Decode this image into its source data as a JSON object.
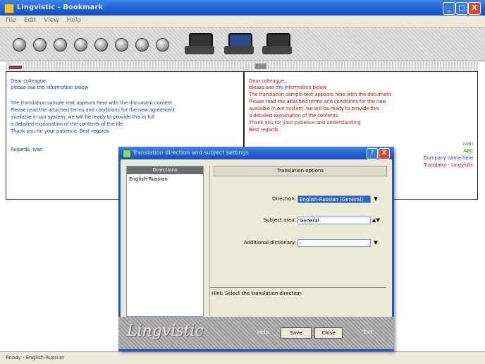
{
  "window": {
    "title": "Lingvistic - Bookmark",
    "controls": {
      "minimize": "_",
      "maximize": "□",
      "close": "X"
    }
  },
  "menu": [
    "File",
    "Edit",
    "View",
    "Help"
  ],
  "toolbar": {
    "round_buttons": 8,
    "big_buttons": 3
  },
  "flags": {
    "left_colors": [
      "#ffffff",
      "#2c4fa3",
      "#d1262a"
    ]
  },
  "left_pane": {
    "lines": [
      {
        "text": "Dear colleague,",
        "color": "#1f3fb5"
      },
      {
        "text": "please see the information below",
        "color": "#1f3fb5"
      },
      {
        "text": "The translation sample text appears here with the document content",
        "color": "#1f3fb5"
      },
      {
        "text": "Please read the attached terms and conditions for the new agreement",
        "color": "#1f3fb5"
      },
      {
        "text": "available in our system, we will be ready to provide this in full",
        "color": "#1f3fb5"
      },
      {
        "text": "a detailed explanation of the contents of the file",
        "color": "#1f3fb5"
      },
      {
        "text": "Thank you for your patience. Best regards",
        "color": "#1f3fb5"
      },
      {
        "text": "Regards, Ivan",
        "color": "#1f3fb5"
      }
    ]
  },
  "right_pane": {
    "lines": [
      {
        "text": "Dear colleague,",
        "color": "#c01818"
      },
      {
        "text": "please see the information below",
        "color": "#c01818"
      },
      {
        "text": "The translation sample text appears here with the document",
        "color": "#c01818"
      },
      {
        "text": "Please read the attached terms and conditions for the new",
        "color": "#c01818"
      },
      {
        "text": "available in our system, we will be ready to provide this",
        "color": "#c01818"
      },
      {
        "text": "a detailed explanation of the contents",
        "color": "#c01818"
      },
      {
        "text": "Thank you for your patience and understanding",
        "color": "#c01818"
      },
      {
        "text": "Best regards",
        "color": "#c01818"
      }
    ],
    "signature": [
      {
        "text": "Ivan",
        "color": "#2a8a2a"
      },
      {
        "text": "ABC",
        "color": "#2a8a2a"
      },
      {
        "text": "Company name here",
        "color": "#1f3fb5"
      },
      {
        "text": "Translator - Lingvistic",
        "color": "#c01818"
      }
    ]
  },
  "dialog": {
    "title": "Translation direction and subject settings",
    "help": "?",
    "close": "X",
    "list_header": "Directions",
    "list_items": [
      "English-Russian"
    ],
    "panel_header": "Translation options",
    "fields": [
      {
        "label": "Direction:",
        "value": "English-Russian (General)",
        "highlight": true
      },
      {
        "label": "Subject area:",
        "value": "General",
        "highlight": false
      },
      {
        "label": "Additional dictionary:",
        "value": "-",
        "highlight": false
      }
    ],
    "hint": "Hint: Select the translation direction",
    "logo": "Lingvistic",
    "buttons": [
      "Help",
      "Save",
      "Close",
      "Exit"
    ]
  },
  "status": {
    "text": "Ready - English-Russian"
  }
}
